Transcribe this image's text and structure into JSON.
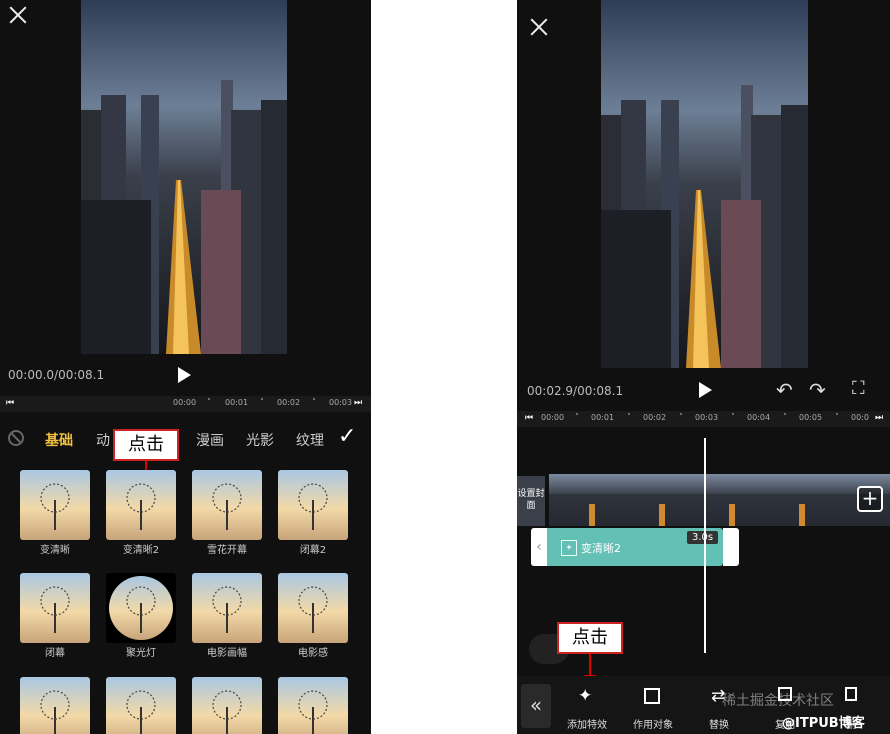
{
  "left": {
    "time": "00:00.0/00:08.1",
    "ruler": [
      "00:00",
      "00:01",
      "00:02",
      "00:03"
    ],
    "categories": [
      {
        "label": "基础",
        "active": true
      },
      {
        "label": "动",
        "active": false
      },
      {
        "label": "漫画",
        "active": false
      },
      {
        "label": "光影",
        "active": false
      },
      {
        "label": "纹理",
        "active": false
      }
    ],
    "callout": "点击",
    "effects": [
      "变清晰",
      "变清晰2",
      "雪花开幕",
      "闭幕2",
      "闭幕",
      "聚光灯",
      "电影画幅",
      "电影感",
      "",
      "",
      "",
      ""
    ]
  },
  "right": {
    "time": "00:02.9/00:08.1",
    "ruler": [
      "00:00",
      "00:01",
      "00:02",
      "00:03",
      "00:04",
      "00:05",
      "00:0"
    ],
    "cover_label": "设置封面",
    "clip_name": "变清晰2",
    "clip_duration": "3.0s",
    "callout": "点击",
    "toolbar": [
      {
        "label": "添加特效",
        "icon": "sparkle-icon"
      },
      {
        "label": "作用对象",
        "icon": "target-icon"
      },
      {
        "label": "替换",
        "icon": "replace-icon"
      },
      {
        "label": "复制",
        "icon": "copy-icon"
      },
      {
        "label": "删",
        "icon": "delete-icon"
      }
    ]
  },
  "watermark": "@ITPUB博客",
  "watermark2": "稀土掘金技术社区"
}
